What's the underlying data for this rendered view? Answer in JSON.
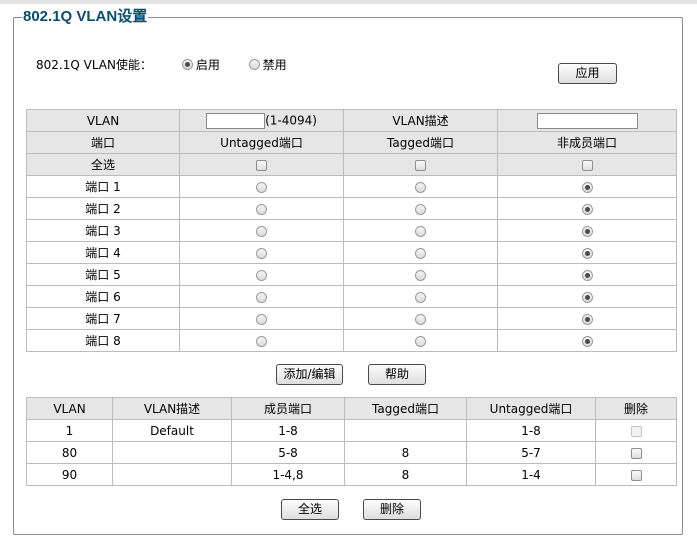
{
  "section_title": "802.1Q VLAN设置",
  "enable": {
    "label": "802.1Q VLAN使能：",
    "options": [
      "启用",
      "禁用"
    ],
    "selected": "启用",
    "apply_button": "应用"
  },
  "config_table": {
    "vlan_label": "VLAN",
    "vlan_id_value": "",
    "vlan_range_hint": "(1-4094)",
    "desc_label": "VLAN描述",
    "desc_value": "",
    "headers": [
      "端口",
      "Untagged端口",
      "Tagged端口",
      "非成员端口"
    ],
    "select_all_label": "全选",
    "ports": [
      {
        "name": "端口 1",
        "mode": "非成员端口"
      },
      {
        "name": "端口 2",
        "mode": "非成员端口"
      },
      {
        "name": "端口 3",
        "mode": "非成员端口"
      },
      {
        "name": "端口 4",
        "mode": "非成员端口"
      },
      {
        "name": "端口 5",
        "mode": "非成员端口"
      },
      {
        "name": "端口 6",
        "mode": "非成员端口"
      },
      {
        "name": "端口 7",
        "mode": "非成员端口"
      },
      {
        "name": "端口 8",
        "mode": "非成员端口"
      }
    ]
  },
  "buttons": {
    "add_edit": "添加/编辑",
    "help": "帮助",
    "select_all": "全选",
    "delete": "删除"
  },
  "vlan_list": {
    "headers": [
      "VLAN",
      "VLAN描述",
      "成员端口",
      "Tagged端口",
      "Untagged端口",
      "删除"
    ],
    "rows": [
      {
        "vlan": "1",
        "desc": "Default",
        "members": "1-8",
        "tagged": "",
        "untagged": "1-8",
        "deletable": false
      },
      {
        "vlan": "80",
        "desc": "",
        "members": "5-8",
        "tagged": "8",
        "untagged": "5-7",
        "deletable": true
      },
      {
        "vlan": "90",
        "desc": "",
        "members": "1-4,8",
        "tagged": "8",
        "untagged": "1-4",
        "deletable": true
      }
    ]
  }
}
